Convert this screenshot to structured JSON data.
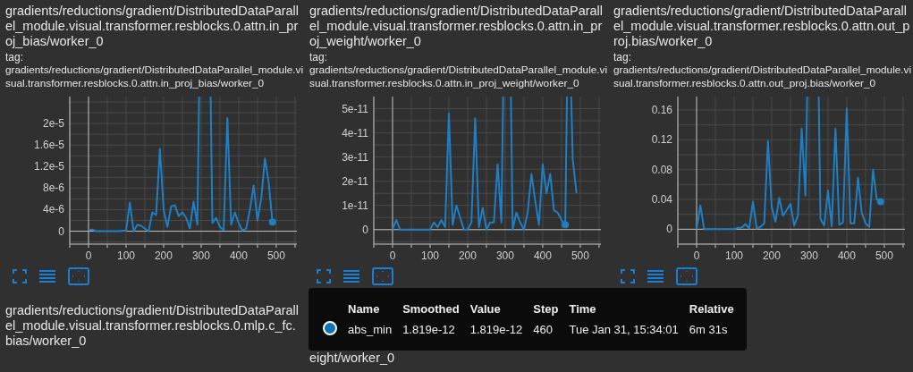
{
  "cards": [
    {
      "title": "gradients/reductions/gradient/DistributedDataParallel_module.visual.transformer.resblocks.0.attn.in_proj_bias/worker_0",
      "tag_label": "tag:",
      "tag": "gradients/reductions/gradient/DistributedDataParallel_module.visual.transformer.resblocks.0.attn.in_proj_bias/worker_0",
      "hover_at_end": true,
      "chart_data": {
        "type": "line",
        "grid": true,
        "x": [
          0,
          10,
          20,
          30,
          40,
          50,
          60,
          70,
          80,
          90,
          100,
          110,
          120,
          130,
          140,
          150,
          160,
          170,
          180,
          190,
          200,
          210,
          220,
          230,
          240,
          250,
          260,
          270,
          280,
          290,
          300,
          310,
          320,
          330,
          340,
          350,
          360,
          370,
          380,
          390,
          400,
          410,
          420,
          430,
          440,
          450,
          460,
          470,
          480,
          490
        ],
        "series": [
          {
            "values": [
              2e-07,
              3e-07,
              0,
              0,
              0,
              0,
              0,
              0,
              0,
              1e-07,
              1e-07,
              5.3e-06,
              0,
              1.2e-06,
              1e-06,
              5e-07,
              0,
              3.5e-06,
              3e-06,
              1.53e-05,
              4e-06,
              8e-07,
              4.6e-06,
              4.8e-06,
              2.8e-06,
              3.5e-06,
              2.5e-06,
              5e-07,
              5.5e-06,
              1.2e-06,
              null,
              null,
              null,
              1.5e-06,
              2.5e-06,
              8e-07,
              2e-07,
              2.1e-05,
              1.2e-06,
              3.5e-06,
              1.5e-06,
              1e-07,
              5e-07,
              4e-06,
              8.5e-06,
              2e-06,
              6e-06,
              1.35e-05,
              9e-06,
              1.7e-06
            ]
          }
        ],
        "xlim": [
          -50,
          555
        ],
        "ylim": [
          -2.4e-06,
          2.5e-05
        ],
        "xticks": [
          0,
          100,
          200,
          300,
          400,
          500
        ],
        "yticks": [
          {
            "value": 0,
            "label": "0"
          },
          {
            "value": 4e-06,
            "label": "4e-6"
          },
          {
            "value": 8e-06,
            "label": "8e-6"
          },
          {
            "value": 1.2e-05,
            "label": "1.2e-5"
          },
          {
            "value": 1.6e-05,
            "label": "1.6e-5"
          },
          {
            "value": 2e-05,
            "label": "2e-5"
          }
        ]
      }
    },
    {
      "title": "gradients/reductions/gradient/DistributedDataParallel_module.visual.transformer.resblocks.0.attn.in_proj_weight/worker_0",
      "tag_label": "tag:",
      "tag": "gradients/reductions/gradient/DistributedDataParallel_module.visual.transformer.resblocks.0.attn.in_proj_weight/worker_0",
      "hover_at_end": false,
      "chart_data": {
        "type": "line",
        "grid": true,
        "x": [
          0,
          10,
          20,
          30,
          40,
          50,
          60,
          70,
          80,
          90,
          100,
          110,
          120,
          130,
          140,
          150,
          160,
          170,
          180,
          190,
          200,
          210,
          220,
          230,
          240,
          250,
          260,
          270,
          280,
          290,
          300,
          310,
          320,
          330,
          340,
          350,
          360,
          370,
          380,
          390,
          400,
          410,
          420,
          430,
          440,
          450,
          460,
          470,
          480,
          490
        ],
        "series": [
          {
            "values": [
              0,
              4e-12,
              0,
              0,
              0,
              0,
              0,
              0,
              0,
              0,
              0,
              3e-12,
              1e-12,
              4e-12,
              1e-12,
              4.8e-11,
              2e-12,
              1e-11,
              5e-12,
              0,
              0,
              3e-12,
              4.6e-11,
              1e-12,
              9e-12,
              0,
              3e-12,
              3e-12,
              2.7e-11,
              3e-12,
              null,
              null,
              0,
              7e-12,
              3e-12,
              0,
              7e-12,
              2.3e-11,
              1.2e-11,
              2e-12,
              2.7e-11,
              1.5e-11,
              2.3e-11,
              8e-12,
              7e-12,
              4e-12,
              2e-12,
              null,
              2.9e-11,
              1.5e-11
            ]
          }
        ],
        "xlim": [
          -50,
          555
        ],
        "ylim": [
          -6e-12,
          5.5e-11
        ],
        "xticks": [
          0,
          100,
          200,
          300,
          400,
          500
        ],
        "yticks": [
          {
            "value": 0,
            "label": "0"
          },
          {
            "value": 1e-11,
            "label": "1e-11"
          },
          {
            "value": 2e-11,
            "label": "2e-11"
          },
          {
            "value": 3e-11,
            "label": "3e-11"
          },
          {
            "value": 4e-11,
            "label": "4e-11"
          },
          {
            "value": 5e-11,
            "label": "5e-11"
          }
        ]
      }
    },
    {
      "title": "gradients/reductions/gradient/DistributedDataParallel_module.visual.transformer.resblocks.0.attn.out_proj.bias/worker_0",
      "tag_label": "tag:",
      "tag": "gradients/reductions/gradient/DistributedDataParallel_module.visual.transformer.resblocks.0.attn.out_proj.bias/worker_0",
      "hover_at_end": true,
      "chart_data": {
        "type": "line",
        "grid": true,
        "x": [
          0,
          10,
          20,
          30,
          40,
          50,
          60,
          70,
          80,
          90,
          100,
          110,
          120,
          130,
          140,
          150,
          160,
          170,
          180,
          190,
          200,
          210,
          220,
          230,
          240,
          250,
          260,
          270,
          280,
          290,
          300,
          310,
          320,
          330,
          340,
          350,
          360,
          370,
          380,
          390,
          400,
          410,
          420,
          430,
          440,
          450,
          460,
          470,
          480,
          490
        ],
        "series": [
          {
            "values": [
              0,
              0.032,
              0,
              0,
              0,
              0,
              0,
              0,
              0,
              0,
              0,
              0.002,
              0.002,
              0.007,
              0.001,
              0.037,
              0.001,
              0.003,
              0.008,
              0.118,
              0.03,
              0.01,
              0.042,
              0.018,
              0.026,
              0.034,
              0.005,
              0.018,
              0.135,
              0.045,
              null,
              null,
              null,
              0.014,
              0.005,
              0.052,
              0.004,
              0.135,
              0.006,
              0.009,
              0.162,
              0.008,
              0.008,
              0.069,
              0.022,
              0.008,
              0.003,
              0.08,
              0.04,
              0.037
            ]
          }
        ],
        "xlim": [
          -50,
          555
        ],
        "ylim": [
          -0.02,
          0.178
        ],
        "xticks": [
          0,
          100,
          200,
          300,
          400,
          500
        ],
        "yticks": [
          {
            "value": 0,
            "label": "0"
          },
          {
            "value": 0.04,
            "label": "0.04"
          },
          {
            "value": 0.08,
            "label": "0.08"
          },
          {
            "value": 0.12,
            "label": "0.12"
          },
          {
            "value": 0.16,
            "label": "0.16"
          }
        ]
      }
    }
  ],
  "bottom_cards": [
    {
      "title": "gradients/reductions/gradient/DistributedDataParallel_module.visual.transformer.resblocks.0.mlp.c_fc.bias/worker_0"
    },
    {
      "title": "eight/worker_0"
    }
  ],
  "tooltip": {
    "columns": [
      "Name",
      "Smoothed",
      "Value",
      "Step",
      "Time",
      "Relative"
    ],
    "rows": [
      {
        "name": "abs_min",
        "smoothed": "1.819e-12",
        "value": "1.819e-12",
        "step": "460",
        "time": "Tue Jan 31, 15:34:01",
        "relative": "6m 31s"
      }
    ]
  }
}
